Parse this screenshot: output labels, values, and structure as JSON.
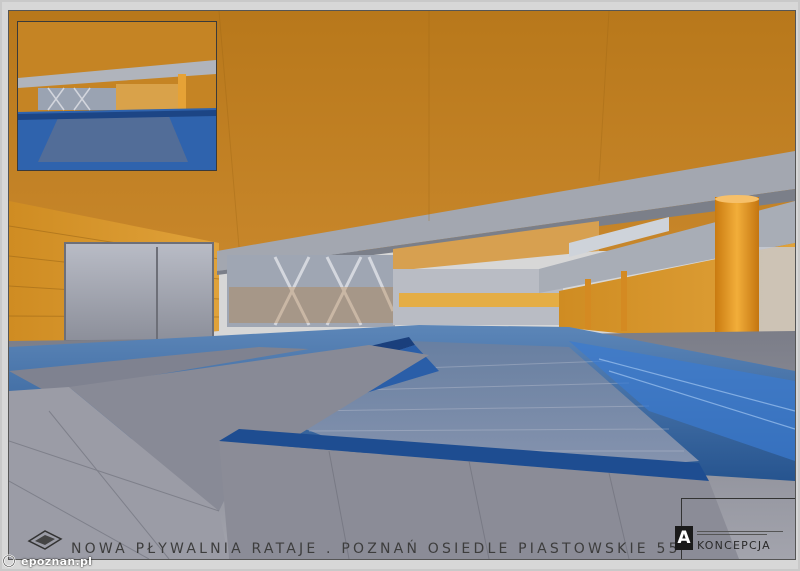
{
  "image": {
    "subject": "architectural-render",
    "colors": {
      "ceiling": "#b8781b",
      "wood_wall": "#d9962a",
      "pool_water": "#2f69b3",
      "pool_deep": "#1d4f92",
      "deck": "#8c8c96",
      "frame": "#d7d7d7"
    }
  },
  "caption": {
    "title": "NOWA PŁYWALNIA RATAJE . POZNAŃ OSIEDLE PIASTOWSKIE 55"
  },
  "logo": {
    "mark": "A",
    "name": "KONCEPCJA"
  },
  "watermark": {
    "text": "epoznan.pl"
  }
}
